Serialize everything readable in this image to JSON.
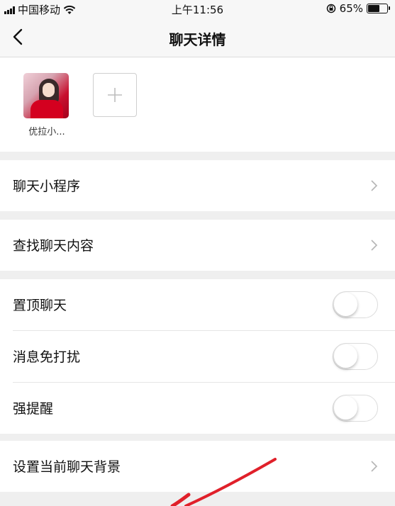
{
  "status_bar": {
    "carrier": "中国移动",
    "time": "上午11:56",
    "battery_percent": "65%",
    "battery_level": 0.65
  },
  "nav": {
    "title": "聊天详情"
  },
  "members": [
    {
      "name": "优拉小..."
    }
  ],
  "sections": {
    "mini_program": {
      "label": "聊天小程序"
    },
    "search": {
      "label": "查找聊天内容"
    },
    "settings": [
      {
        "label": "置顶聊天",
        "on": false
      },
      {
        "label": "消息免打扰",
        "on": false
      },
      {
        "label": "强提醒",
        "on": false
      }
    ],
    "background": {
      "label": "设置当前聊天背景"
    }
  },
  "colors": {
    "accent_red": "#e0202a",
    "page_bg": "#efefef",
    "cell_bg": "#ffffff"
  }
}
